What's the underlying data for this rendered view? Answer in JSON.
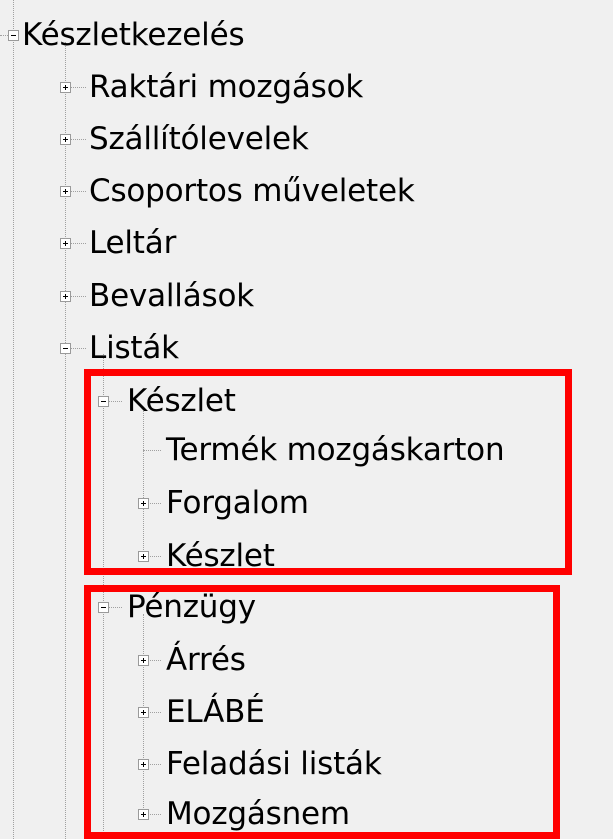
{
  "tree": {
    "root": {
      "label": "Készletkezelés",
      "expanded": true
    },
    "children": [
      {
        "label": "Raktári mozgások",
        "expanded": false
      },
      {
        "label": "Szállítólevelek",
        "expanded": false
      },
      {
        "label": "Csoportos műveletek",
        "expanded": false
      },
      {
        "label": "Leltár",
        "expanded": false
      },
      {
        "label": "Bevallások",
        "expanded": false
      },
      {
        "label": "Listák",
        "expanded": true
      }
    ],
    "lists": {
      "keszlet_group": {
        "label": "Készlet",
        "expanded": true,
        "items": [
          {
            "label": "Termék mozgáskarton",
            "expandable": false
          },
          {
            "label": "Forgalom",
            "expanded": false
          },
          {
            "label": "Készlet",
            "expanded": false
          }
        ]
      },
      "penzugy_group": {
        "label": "Pénzügy",
        "expanded": true,
        "items": [
          {
            "label": "Árrés",
            "expanded": false
          },
          {
            "label": "ELÁBÉ",
            "expanded": false
          },
          {
            "label": "Feladási listák",
            "expanded": false
          },
          {
            "label": "Mozgásnem",
            "expanded": false
          }
        ]
      }
    }
  },
  "colors": {
    "background": "#f0f0f0",
    "highlight": "#ff0000",
    "tree_lines": "#a0a0a0"
  }
}
